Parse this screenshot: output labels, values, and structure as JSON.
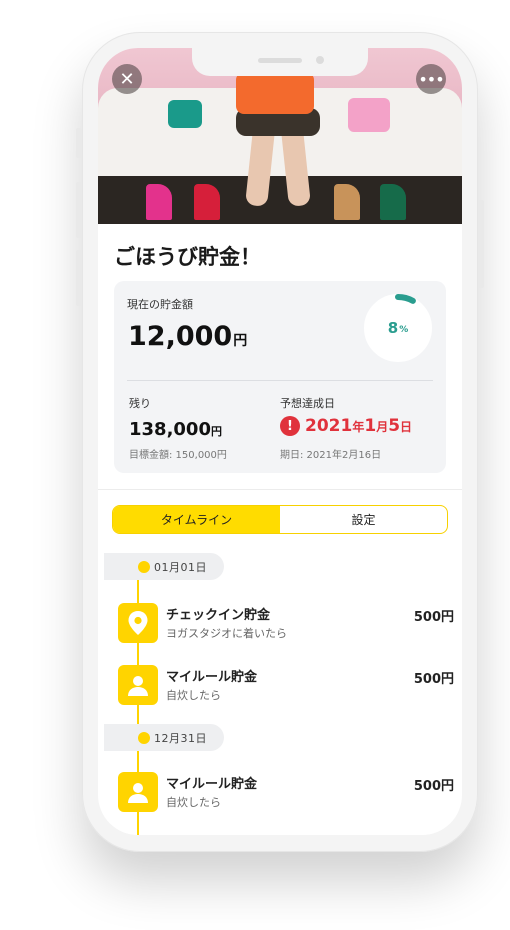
{
  "header": {
    "title": "ごほうび貯金！"
  },
  "summary": {
    "current_label": "現在の貯金額",
    "current_amount": "12,000",
    "currency_unit": "円",
    "progress_percent": 8,
    "progress_text": "8",
    "percent_sign": "%",
    "remaining_label": "残り",
    "remaining_amount": "138,000",
    "target_text": "目標金額: 150,000円",
    "expected_label": "予想達成日",
    "expected_year": "2021",
    "expected_month": "1",
    "expected_day": "5",
    "year_unit": "年",
    "month_unit": "月",
    "day_unit": "日",
    "deadline_text": "期日: 2021年2月16日"
  },
  "tabs": [
    {
      "label": "タイムライン",
      "active": true
    },
    {
      "label": "設定",
      "active": false
    }
  ],
  "timeline": {
    "groups": [
      {
        "date": "01月01日",
        "entries": [
          {
            "icon": "location-pin-icon",
            "title": "チェックイン貯金",
            "subtitle": "ヨガスタジオに着いたら",
            "amount": "500円"
          },
          {
            "icon": "person-icon",
            "title": "マイルール貯金",
            "subtitle": "自炊したら",
            "amount": "500円"
          }
        ]
      },
      {
        "date": "12月31日",
        "entries": [
          {
            "icon": "person-icon",
            "title": "マイルール貯金",
            "subtitle": "自炊したら",
            "amount": "500円"
          }
        ]
      }
    ]
  },
  "colors": {
    "accent_yellow": "#ffd400",
    "alert_red": "#e0323c",
    "progress_teal": "#2a9d8f"
  },
  "icons": {
    "close": "close-icon",
    "more": "more-icon",
    "alert": "alert-icon"
  }
}
